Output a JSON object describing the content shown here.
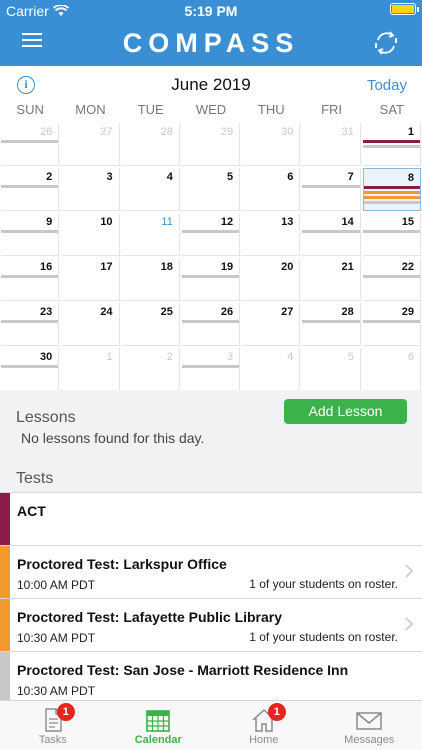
{
  "status": {
    "carrier": "Carrier",
    "time": "5:19 PM"
  },
  "nav": {
    "logo": "COMPASS"
  },
  "calendar": {
    "month_title": "June 2019",
    "today_label": "Today",
    "weekdays": [
      "SUN",
      "MON",
      "TUE",
      "WED",
      "THU",
      "FRI",
      "SAT"
    ],
    "cells": [
      {
        "day": "26",
        "other": true,
        "bars": [
          "#c8c8c8"
        ]
      },
      {
        "day": "27",
        "other": true,
        "bars": []
      },
      {
        "day": "28",
        "other": true,
        "bars": []
      },
      {
        "day": "29",
        "other": true,
        "bars": []
      },
      {
        "day": "30",
        "other": true,
        "bars": []
      },
      {
        "day": "31",
        "other": true,
        "bars": []
      },
      {
        "day": "1",
        "bars": [
          "#8b1c47",
          "#c8c8c8"
        ]
      },
      {
        "day": "2",
        "bars": [
          "#c8c8c8"
        ]
      },
      {
        "day": "3",
        "bars": []
      },
      {
        "day": "4",
        "bars": []
      },
      {
        "day": "5",
        "bars": []
      },
      {
        "day": "6",
        "bars": []
      },
      {
        "day": "7",
        "bars": [
          "#c8c8c8"
        ]
      },
      {
        "day": "8",
        "selected": true,
        "bars": [
          "#8b1c47",
          "#f29a2e",
          "#f29a2e",
          "#c8c8c8"
        ]
      },
      {
        "day": "9",
        "bars": [
          "#c8c8c8"
        ]
      },
      {
        "day": "10",
        "bars": []
      },
      {
        "day": "11",
        "today": true,
        "bars": []
      },
      {
        "day": "12",
        "bars": [
          "#c8c8c8"
        ]
      },
      {
        "day": "13",
        "bars": []
      },
      {
        "day": "14",
        "bars": [
          "#c8c8c8"
        ]
      },
      {
        "day": "15",
        "bars": [
          "#c8c8c8"
        ]
      },
      {
        "day": "16",
        "bars": [
          "#c8c8c8"
        ]
      },
      {
        "day": "17",
        "bars": []
      },
      {
        "day": "18",
        "bars": []
      },
      {
        "day": "19",
        "bars": [
          "#c8c8c8"
        ]
      },
      {
        "day": "20",
        "bars": []
      },
      {
        "day": "21",
        "bars": []
      },
      {
        "day": "22",
        "bars": [
          "#c8c8c8"
        ]
      },
      {
        "day": "23",
        "bars": [
          "#c8c8c8"
        ]
      },
      {
        "day": "24",
        "bars": []
      },
      {
        "day": "25",
        "bars": []
      },
      {
        "day": "26",
        "bars": [
          "#c8c8c8"
        ]
      },
      {
        "day": "27",
        "bars": []
      },
      {
        "day": "28",
        "bars": [
          "#c8c8c8"
        ]
      },
      {
        "day": "29",
        "bars": [
          "#c8c8c8"
        ]
      },
      {
        "day": "30",
        "bars": [
          "#c8c8c8"
        ]
      },
      {
        "day": "1",
        "other": true,
        "bars": []
      },
      {
        "day": "2",
        "other": true,
        "bars": []
      },
      {
        "day": "3",
        "other": true,
        "bars": [
          "#c8c8c8"
        ]
      },
      {
        "day": "4",
        "other": true,
        "bars": []
      },
      {
        "day": "5",
        "other": true,
        "bars": []
      },
      {
        "day": "6",
        "other": true,
        "bars": []
      }
    ]
  },
  "lessons": {
    "heading": "Lessons",
    "add_button": "Add Lesson",
    "empty_text": "No lessons found for this day."
  },
  "tests": {
    "heading": "Tests",
    "items": [
      {
        "title": "ACT",
        "time": "",
        "note": "",
        "color": "#8b1c47",
        "chevron": false
      },
      {
        "title": "Proctored Test: Larkspur Office",
        "time": "10:00 AM PDT",
        "note": "1 of your students on roster.",
        "color": "#f29a2e",
        "chevron": true
      },
      {
        "title": "Proctored Test: Lafayette Public Library",
        "time": "10:30 AM PDT",
        "note": "1 of your students on roster.",
        "color": "#f29a2e",
        "chevron": true
      },
      {
        "title": "Proctored Test: San Jose - Marriott Residence Inn",
        "time": "10:30 AM PDT",
        "note": "",
        "color": "#c8c8c8",
        "chevron": false
      }
    ]
  },
  "tabs": [
    {
      "label": "Tasks",
      "icon": "document-icon",
      "badge": "1",
      "active": false
    },
    {
      "label": "Calendar",
      "icon": "calendar-icon",
      "badge": "",
      "active": true
    },
    {
      "label": "Home",
      "icon": "home-icon",
      "badge": "1",
      "active": false
    },
    {
      "label": "Messages",
      "icon": "envelope-icon",
      "badge": "",
      "active": false
    }
  ],
  "colors": {
    "brand": "#3a8fd4",
    "accent_green": "#3cb34a",
    "badge_red": "#e5261f"
  }
}
